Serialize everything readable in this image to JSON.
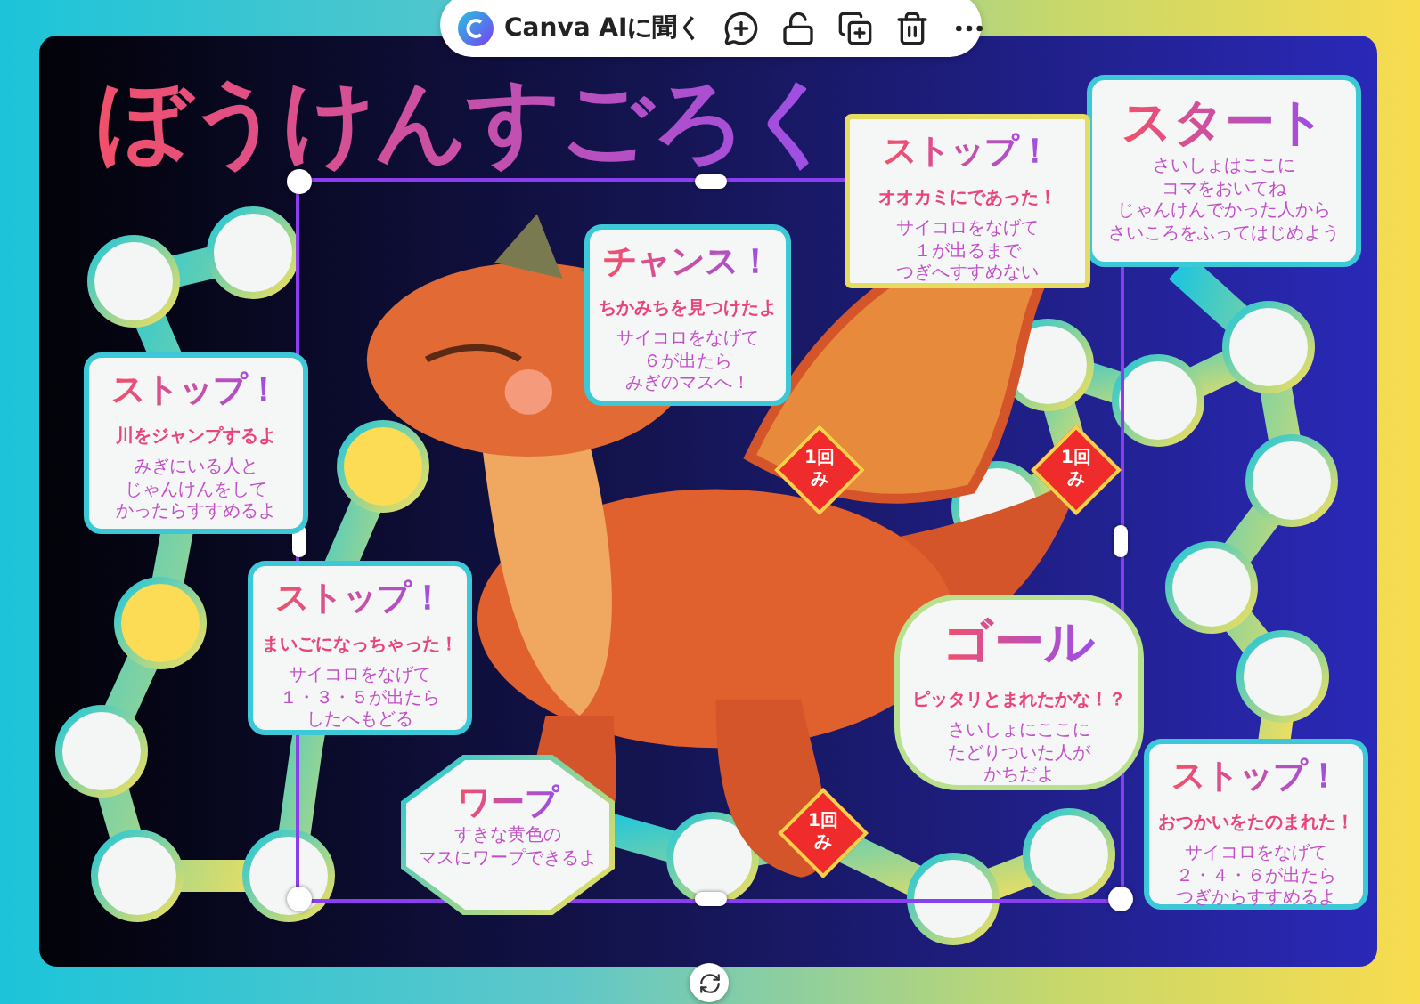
{
  "toolbar": {
    "label": "Canva AIに聞く"
  },
  "title": "ぼうけんすごろく",
  "cards": [
    {
      "kind": "rect",
      "heading": "スタート",
      "body": [
        "さいしょはここに",
        "コマをおいてね",
        "じゃんけんでかった人から",
        "さいころをふってはじめよう"
      ]
    },
    {
      "kind": "burst",
      "heading": "ストップ！",
      "subtitle": "オオカミにであった！",
      "body": [
        "サイコロをなげて",
        "１が出るまで",
        "つぎへすすめない"
      ]
    },
    {
      "kind": "rect",
      "heading": "チャンス！",
      "subtitle": "ちかみちを見つけたよ",
      "body": [
        "サイコロをなげて",
        "６が出たら",
        "みぎのマスへ！"
      ]
    },
    {
      "kind": "rect",
      "heading": "ストップ！",
      "subtitle": "川をジャンプするよ",
      "body": [
        "みぎにいる人と",
        "じゃんけんをして",
        "かったらすすめるよ"
      ]
    },
    {
      "kind": "rect",
      "heading": "ストップ！",
      "subtitle": "まいごになっちゃった！",
      "body": [
        "サイコロをなげて",
        "１・３・５が出たら",
        "したへもどる"
      ]
    },
    {
      "kind": "cloud",
      "heading": "ゴール",
      "subtitle": "ピッタリとまれたかな！？",
      "body": [
        "さいしょにここに",
        "たどりついた人が",
        "かちだよ"
      ]
    },
    {
      "kind": "octagon",
      "heading": "ワープ",
      "body": [
        "すきな黄色の",
        "マスにワープできるよ"
      ]
    },
    {
      "kind": "rect",
      "heading": "ストップ！",
      "subtitle": "おつかいをたのまれた！",
      "body": [
        "サイコロをなげて",
        "２・４・６が出たら",
        "つぎからすすめるよ"
      ]
    }
  ],
  "diamonds": [
    {
      "label": [
        "1回",
        "み"
      ]
    },
    {
      "label": [
        "1回",
        "み"
      ]
    },
    {
      "label": [
        "1回",
        "み"
      ]
    }
  ]
}
